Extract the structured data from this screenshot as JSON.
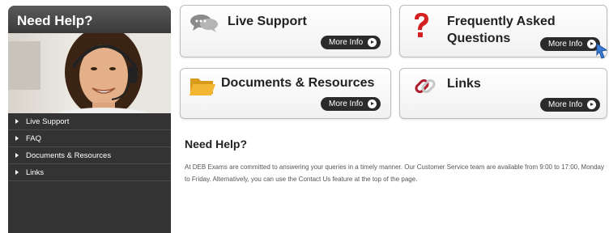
{
  "sidebar": {
    "title": "Need Help?",
    "menu": [
      {
        "label": "Live Support"
      },
      {
        "label": "FAQ"
      },
      {
        "label": "Documents & Resources"
      },
      {
        "label": "Links"
      }
    ]
  },
  "cards": [
    {
      "title": "Live Support",
      "button": "More Info",
      "icon": "chat-bubbles-icon"
    },
    {
      "title": "Frequently Asked Questions",
      "title_line1": "Frequently Asked",
      "title_line2": "Questions",
      "button": "More Info",
      "icon": "question-mark-icon"
    },
    {
      "title": "Documents & Resources",
      "button": "More Info",
      "icon": "folder-icon"
    },
    {
      "title": "Links",
      "button": "More Info",
      "icon": "link-icon"
    }
  ],
  "help": {
    "heading": "Need Help?",
    "body": "At DEB Exams are committed to answering your queries in a timely manner. Our Customer Service team are available from 9:00 to 17:00, Monday to Friday. Alternatively, you can use the Contact Us feature at the top of the page."
  },
  "colors": {
    "sidebar_bg": "#333333",
    "button_bg": "#2b2b2b",
    "question_red": "#d42020",
    "folder_yellow": "#f2b632"
  }
}
